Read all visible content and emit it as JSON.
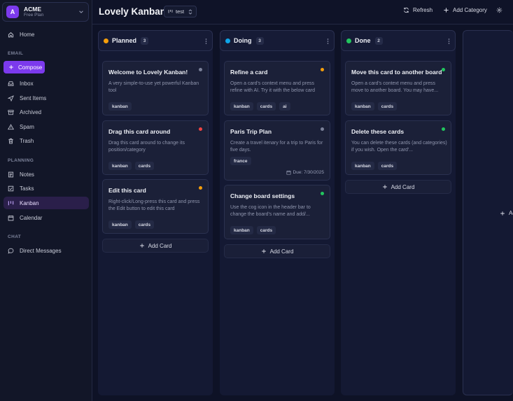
{
  "org": {
    "initial": "A",
    "name": "ACME",
    "plan": "Free Plan"
  },
  "sidebar": {
    "home": "Home",
    "email_section": "EMAIL",
    "compose": "Compose",
    "inbox": "Inbox",
    "sent": "Sent Items",
    "archived": "Archived",
    "spam": "Spam",
    "trash": "Trash",
    "planning_section": "PLANNING",
    "notes": "Notes",
    "tasks": "Tasks",
    "kanban": "Kanban",
    "calendar": "Calendar",
    "chat_section": "CHAT",
    "dms": "Direct Messages"
  },
  "header": {
    "title": "Lovely Kanban",
    "board": "test",
    "refresh": "Refresh",
    "add_category": "Add Category"
  },
  "add_card_label": "Add Card",
  "add_column_label": "Ad",
  "columns": [
    {
      "title": "Planned",
      "count": "3",
      "color": "#f59e0b",
      "cards": [
        {
          "title": "Welcome to Lovely Kanban!",
          "desc": "A very simple-to-use yet powerful Kanban tool",
          "dot": "#7b8199",
          "tags": [
            "kanban"
          ]
        },
        {
          "title": "Drag this card around",
          "desc": "Drag this card around to change its position/category",
          "dot": "#ef4444",
          "tags": [
            "kanban",
            "cards"
          ]
        },
        {
          "title": "Edit this card",
          "desc": "Right-click/Long-press this card and press the Edit button to edit this card",
          "dot": "#f59e0b",
          "tags": [
            "kanban",
            "cards"
          ]
        }
      ]
    },
    {
      "title": "Doing",
      "count": "3",
      "color": "#0ea5e9",
      "cards": [
        {
          "title": "Refine a card",
          "desc": "Open a card's context menu and press refine with AI. Try it with the below card",
          "dot": "#f59e0b",
          "tags": [
            "kanban",
            "cards",
            "ai"
          ]
        },
        {
          "title": "Paris Trip Plan",
          "desc": "Create a travel itenary for a trip to Paris for five days.",
          "dot": "#7b8199",
          "tags": [
            "france"
          ],
          "due": "Due: 7/30/2025"
        },
        {
          "title": "Change board settings",
          "desc": "Use the cog icon in the header bar to change the board's name and add/...",
          "dot": "#22c55e",
          "tags": [
            "kanban",
            "cards"
          ]
        }
      ]
    },
    {
      "title": "Done",
      "count": "2",
      "color": "#22c55e",
      "cards": [
        {
          "title": "Move this card to another board",
          "desc": "Open a card's context menu and press move to another board. You may have...",
          "dot": "#22c55e",
          "tags": [
            "kanban",
            "cards"
          ]
        },
        {
          "title": "Delete these cards",
          "desc": "You can delete these cards (and categories) if you wish. Open the card'...",
          "dot": "#22c55e",
          "tags": [
            "kanban",
            "cards"
          ]
        }
      ]
    }
  ]
}
